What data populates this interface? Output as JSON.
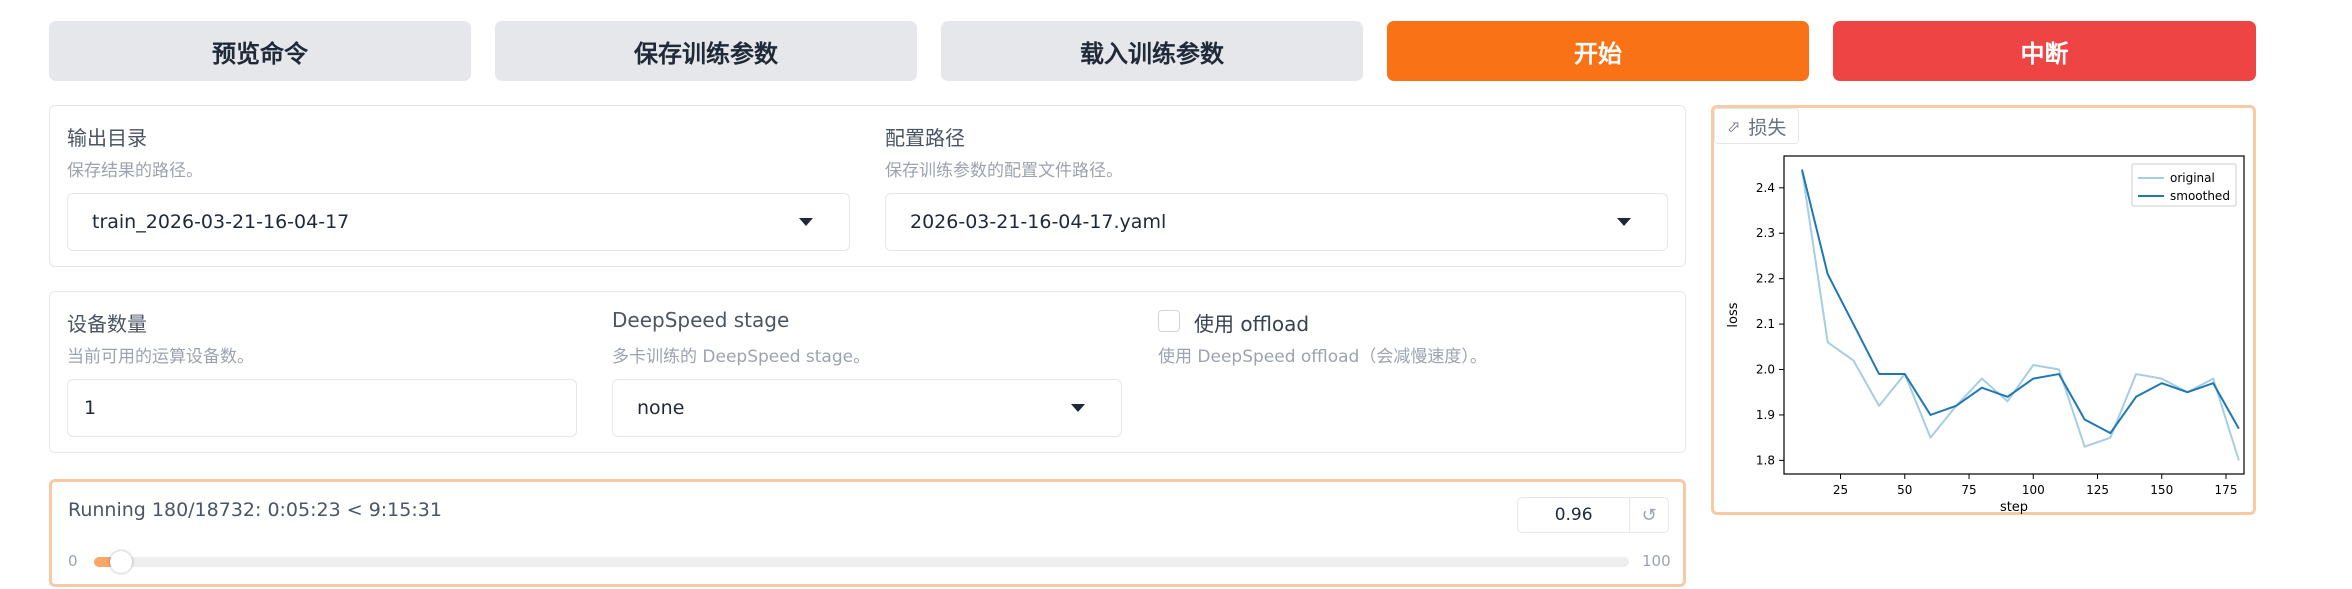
{
  "toolbar": {
    "preview_label": "预览命令",
    "save_label": "保存训练参数",
    "load_label": "载入训练参数",
    "start_label": "开始",
    "abort_label": "中断"
  },
  "output_config": {
    "output_dir": {
      "label": "输出目录",
      "info": "保存结果的路径。",
      "value": "train_2026-03-21-16-04-17"
    },
    "config_path": {
      "label": "配置路径",
      "info": "保存训练参数的配置文件路径。",
      "value": "2026-03-21-16-04-17.yaml"
    }
  },
  "device_config": {
    "device_count": {
      "label": "设备数量",
      "info": "当前可用的运算设备数。",
      "value": "1"
    },
    "ds_stage": {
      "label": "DeepSpeed stage",
      "info": "多卡训练的 DeepSpeed stage。",
      "value": "none"
    },
    "ds_offload": {
      "label": "使用 offload",
      "info": "使用 DeepSpeed offload（会减慢速度）。",
      "checked": false
    }
  },
  "progress": {
    "status": "Running 180/18732: 0:05:23 < 9:15:31",
    "value_display": "0.96",
    "slider_min": "0",
    "slider_max": "100",
    "slider_value": 0.96,
    "reset_icon": "reset-icon"
  },
  "loss_plot": {
    "label": "损失",
    "icon": "line-chart-icon",
    "accent": "#f9c9a3"
  },
  "colors": {
    "orange": "#f97316",
    "red": "#ef4444",
    "gray": "#e5e7eb",
    "original_line": "#a6cee3",
    "smoothed_line": "#1f78b4"
  },
  "chart_data": {
    "type": "line",
    "xlabel": "step",
    "ylabel": "loss",
    "xlim": [
      3,
      182
    ],
    "ylim": [
      1.77,
      2.47
    ],
    "xticks": [
      25,
      50,
      75,
      100,
      125,
      150,
      175
    ],
    "yticks": [
      1.8,
      1.9,
      2.0,
      2.1,
      2.2,
      2.3,
      2.4
    ],
    "legend": "top-right",
    "series": [
      {
        "name": "original",
        "x": [
          10,
          20,
          30,
          40,
          50,
          60,
          70,
          80,
          90,
          100,
          110,
          120,
          130,
          140,
          150,
          160,
          170,
          180
        ],
        "y": [
          2.44,
          2.06,
          2.02,
          1.92,
          1.99,
          1.85,
          1.92,
          1.98,
          1.93,
          2.01,
          2.0,
          1.83,
          1.85,
          1.99,
          1.98,
          1.95,
          1.98,
          1.8
        ]
      },
      {
        "name": "smoothed",
        "x": [
          10,
          20,
          30,
          40,
          50,
          60,
          70,
          80,
          90,
          100,
          110,
          120,
          130,
          140,
          150,
          160,
          170,
          180
        ],
        "y": [
          2.44,
          2.21,
          2.1,
          1.99,
          1.99,
          1.9,
          1.92,
          1.96,
          1.94,
          1.98,
          1.99,
          1.89,
          1.86,
          1.94,
          1.97,
          1.95,
          1.97,
          1.87
        ]
      }
    ]
  }
}
